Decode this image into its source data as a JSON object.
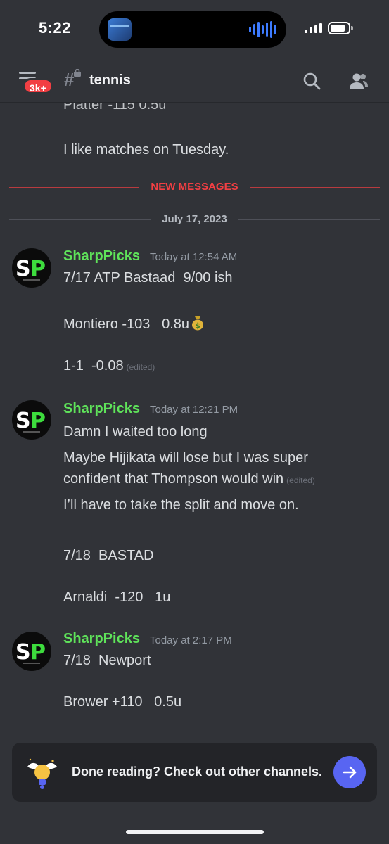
{
  "status_bar": {
    "time": "5:22"
  },
  "header": {
    "badge": "3k+",
    "channel": "tennis"
  },
  "chat": {
    "previous_clipped": "Platter  -115   0.5u",
    "previous_last": "I like matches on Tuesday.",
    "new_messages_label": "NEW MESSAGES",
    "date_label": "July 17, 2023",
    "messages": [
      {
        "author": "SharpPicks",
        "time": "Today at 12:54 AM",
        "lines": [
          "7/17 ATP Bastaad  9/00 ish",
          "Montiero -103   0.8u",
          "1-1  -0.08"
        ],
        "edited": "(edited)"
      },
      {
        "author": "SharpPicks",
        "time": "Today at 12:21 PM",
        "lines": [
          "Damn I waited too long",
          "Maybe Hijikata will lose but I was super",
          "confident that Thompson would win",
          "I’ll have to take the split and move on.",
          "7/18  BASTAD",
          "Arnaldi  -120   1u"
        ],
        "edited": "(edited)"
      },
      {
        "author": "SharpPicks",
        "time": "Today at 2:17 PM",
        "lines": [
          "7/18  Newport",
          "Brower +110   0.5u"
        ]
      }
    ]
  },
  "banner": {
    "text": "Done reading? Check out other channels."
  },
  "colors": {
    "accent": "#5865f2",
    "author": "#5fe35a",
    "new_messages": "#f23f43",
    "background": "#313338"
  }
}
